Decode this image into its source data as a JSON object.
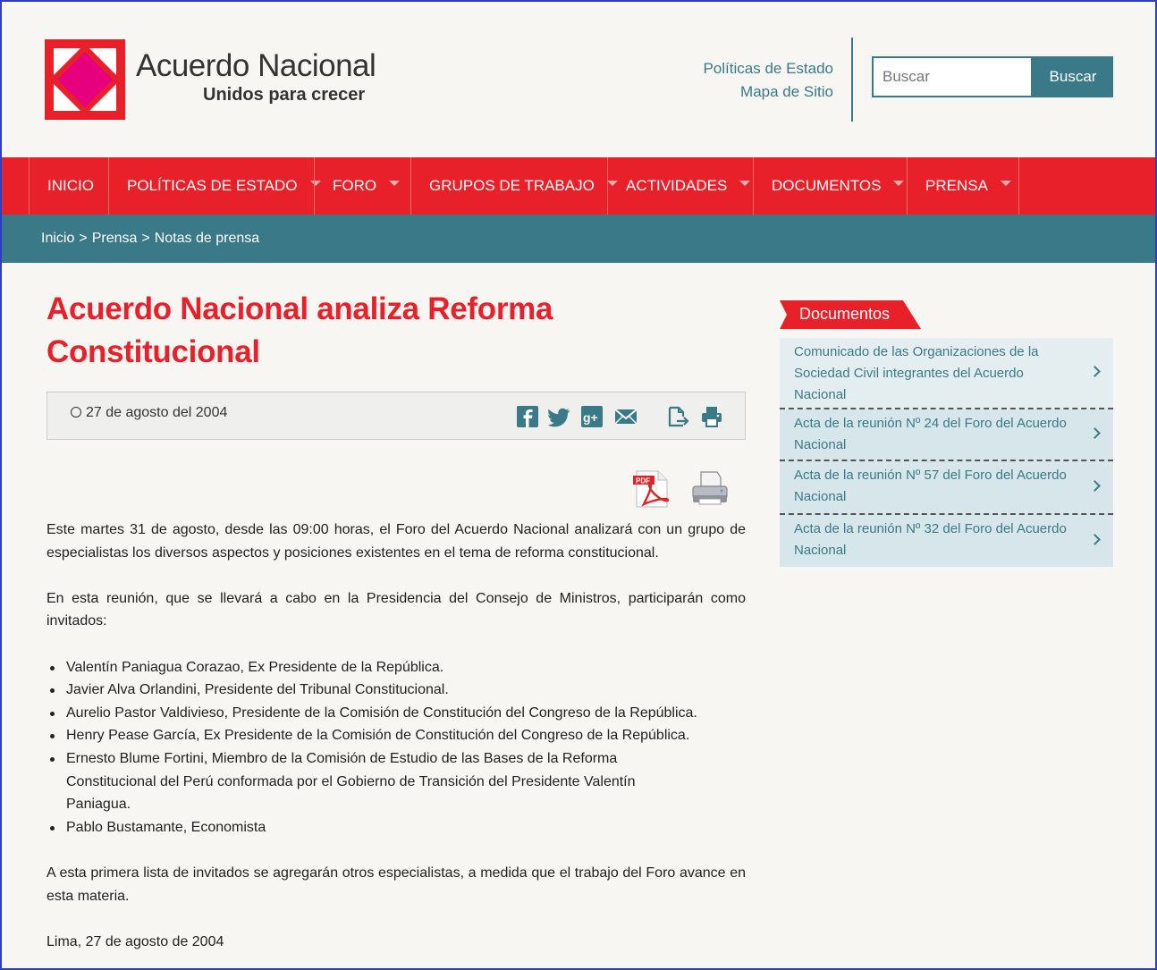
{
  "brand": {
    "title": "Acuerdo Nacional",
    "subtitle": "Unidos para crecer",
    "colors": {
      "red": "#e8202a",
      "teal": "#3a7a88",
      "magenta": "#e6007e"
    }
  },
  "top_links": [
    {
      "label": "Políticas de Estado"
    },
    {
      "label": "Mapa de Sitio"
    }
  ],
  "search": {
    "placeholder": "Buscar",
    "button_label": "Buscar"
  },
  "nav": [
    {
      "label": "INICIO",
      "has_dropdown": false
    },
    {
      "label": "POLÍTICAS DE ESTADO",
      "has_dropdown": true
    },
    {
      "label": "FORO",
      "has_dropdown": true
    },
    {
      "label": "GRUPOS DE TRABAJO",
      "has_dropdown": true
    },
    {
      "label": "ACTIVIDADES",
      "has_dropdown": true
    },
    {
      "label": "DOCUMENTOS",
      "has_dropdown": true
    },
    {
      "label": "PRENSA",
      "has_dropdown": true
    }
  ],
  "breadcrumb": {
    "items": [
      "Inicio",
      "Prensa",
      "Notas de prensa"
    ],
    "separator": ">"
  },
  "article": {
    "title": "Acuerdo Nacional analiza Reforma Constitucional",
    "date": "27 de agosto del 2004",
    "share_icons": [
      "facebook-icon",
      "twitter-icon",
      "google-plus-icon",
      "email-icon",
      "export-icon",
      "print-icon"
    ],
    "paragraph_1": "Este martes 31 de agosto, desde las 09:00 horas, el Foro del Acuerdo Nacional analizará con un grupo de especialistas los diversos aspectos y posiciones existentes en el tema de reforma constitucional.",
    "paragraph_2": "En esta reunión, que se llevará a cabo en la Presidencia del Consejo de Ministros, participarán como invitados:",
    "invitees": [
      "Valentín Paniagua Corazao, Ex Presidente de la República.",
      "Javier Alva Orlandini, Presidente del Tribunal Constitucional.",
      "Aurelio Pastor Valdivieso, Presidente de la Comisión de Constitución del Congreso de la República.",
      "Henry Pease García, Ex Presidente de la Comisión de Constitución del Congreso de la República.",
      "Ernesto Blume Fortini, Miembro de la Comisión de Estudio de las Bases de la Reforma Constitucional del Perú conformada por el Gobierno de Transición del Presidente Valentín Paniagua.",
      "Pablo Bustamante, Economista"
    ],
    "paragraph_3": "A esta primera lista de invitados se agregarán otros especialistas, a medida que el trabajo del Foro avance en esta materia.",
    "signoff": "Lima, 27 de agosto de 2004"
  },
  "sidebar": {
    "heading": "Documentos",
    "documents": [
      {
        "label": "Comunicado de las Organizaciones de la Sociedad Civil integrantes del Acuerdo Nacional"
      },
      {
        "label": "Acta de la reunión Nº 24 del Foro del Acuerdo Nacional"
      },
      {
        "label": "Acta de la reunión Nº 57 del Foro del Acuerdo Nacional"
      },
      {
        "label": "Acta de la reunión Nº 32 del Foro del Acuerdo Nacional"
      }
    ]
  }
}
